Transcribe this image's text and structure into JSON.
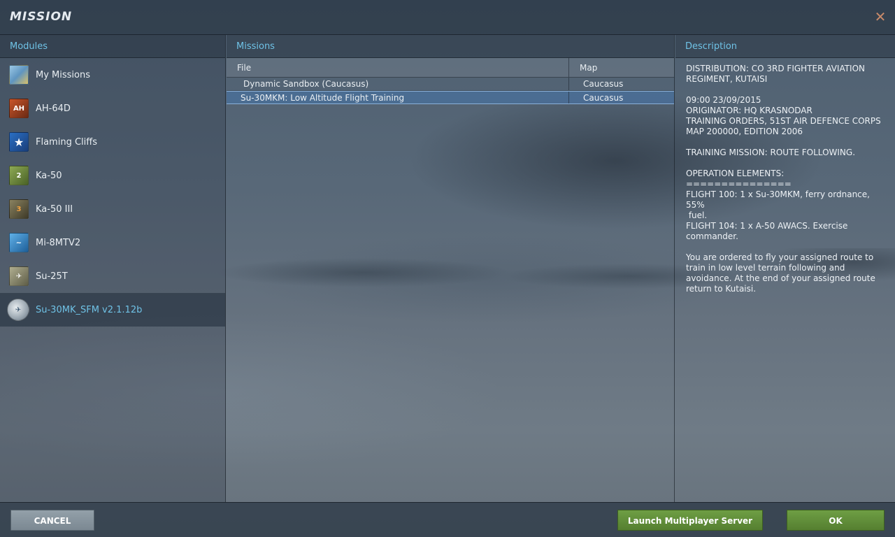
{
  "window": {
    "title": "MISSION"
  },
  "modules": {
    "header": "Modules",
    "items": [
      {
        "label": "My Missions",
        "icon": "map-icon",
        "color": "#7fb4d8"
      },
      {
        "label": "AH-64D",
        "icon": "apache-icon",
        "color": "#a23b1f"
      },
      {
        "label": "Flaming Cliffs",
        "icon": "star-icon",
        "color": "#1f5fb0"
      },
      {
        "label": "Ka-50",
        "icon": "ka50-icon",
        "color": "#6e8a3e"
      },
      {
        "label": "Ka-50 III",
        "icon": "ka50-3-icon",
        "color": "#6f6a4a"
      },
      {
        "label": "Mi-8MTV2",
        "icon": "mi8-icon",
        "color": "#3f8fcf"
      },
      {
        "label": "Su-25T",
        "icon": "su25-icon",
        "color": "#8a8a70"
      },
      {
        "label": "Su-30MK_SFM v2.1.12b",
        "icon": "su30-icon",
        "color": "#c9d2da",
        "selected": true
      }
    ]
  },
  "missions": {
    "header": "Missions",
    "columns": {
      "file": "File",
      "map": "Map"
    },
    "rows": [
      {
        "file": "Dynamic Sandbox (Caucasus)",
        "map": "Caucasus",
        "selected": false
      },
      {
        "file": "Su-30MKM: Low Altitude Flight Training",
        "map": "Caucasus",
        "selected": true
      }
    ]
  },
  "description": {
    "header": "Description",
    "text": "DISTRIBUTION: CO 3RD FIGHTER AVIATION\nREGIMENT, KUTAISI\n\n09:00 23/09/2015\nORIGINATOR: HQ KRASNODAR\nTRAINING ORDERS, 51ST AIR DEFENCE CORPS\nMAP 200000, EDITION 2006\n\nTRAINING MISSION: ROUTE FOLLOWING.\n\nOPERATION ELEMENTS:\n===============\nFLIGHT 100: 1 x Su-30MKM, ferry ordnance, 55%\n fuel.\nFLIGHT 104: 1 x A-50 AWACS. Exercise\ncommander.\n\nYou are ordered to fly your assigned route to\ntrain in low level terrain following and\navoidance. At the end of your assigned route\nreturn to Kutaisi."
  },
  "buttons": {
    "cancel": "CANCEL",
    "launch_server": "Launch Multiplayer Server",
    "ok": "OK"
  }
}
